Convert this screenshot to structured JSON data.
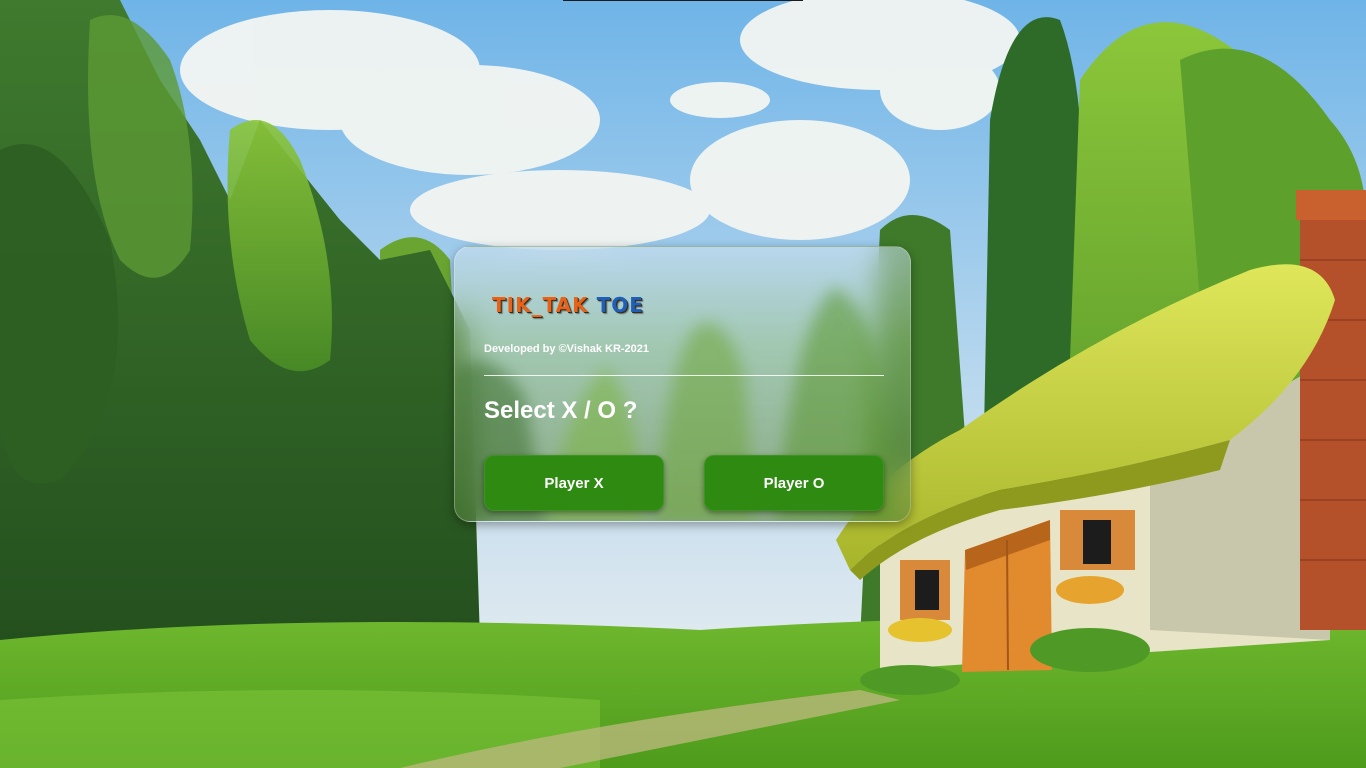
{
  "game": {
    "title_part1": "TIK_TAK",
    "title_part2": "TOE",
    "credit": "Developed by ©Vishak KR-2021",
    "prompt": "Select X / O ?",
    "player_x_label": "Player X",
    "player_o_label": "Player O"
  },
  "colors": {
    "button": "#2e8a10",
    "title_part1": "#e8621a",
    "title_part2": "#1f5fb8",
    "text": "#ffffff"
  }
}
